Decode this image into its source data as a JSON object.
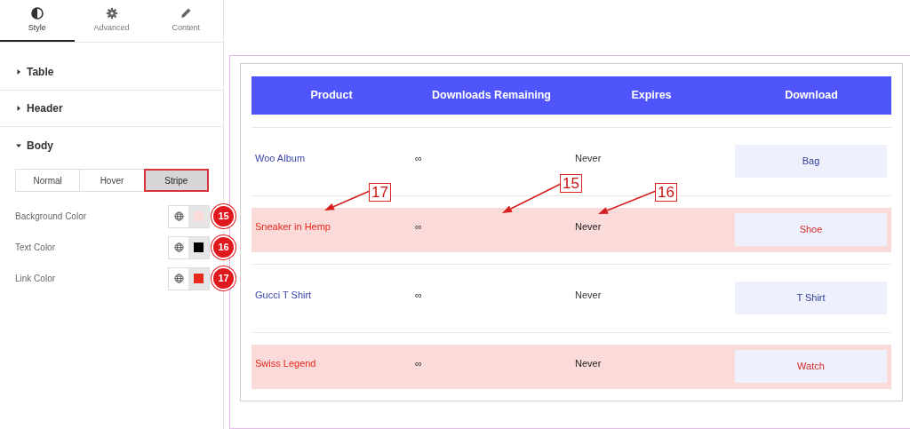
{
  "panel_tabs": [
    {
      "label": "Style",
      "selected": true
    },
    {
      "label": "Advanced",
      "selected": false
    },
    {
      "label": "Content",
      "selected": false
    }
  ],
  "sections": [
    {
      "label": "Table",
      "expanded": false
    },
    {
      "label": "Header",
      "expanded": false
    },
    {
      "label": "Body",
      "expanded": true
    }
  ],
  "state_tabs": [
    {
      "label": "Normal",
      "selected": false
    },
    {
      "label": "Hover",
      "selected": false
    },
    {
      "label": "Stripe",
      "selected": true
    }
  ],
  "color_controls": [
    {
      "label": "Background Color",
      "color": "#fbdada",
      "marker": "15"
    },
    {
      "label": "Text Color",
      "color": "#000000",
      "marker": "16"
    },
    {
      "label": "Link Color",
      "color": "#e8291c",
      "marker": "17"
    }
  ],
  "table": {
    "columns": [
      "Product",
      "Downloads Remaining",
      "Expires",
      "Download"
    ],
    "rows": [
      {
        "product": "Woo Album",
        "remaining": "∞",
        "expires": "Never",
        "download": "Bag",
        "striped": false
      },
      {
        "product": "Sneaker in Hemp",
        "remaining": "∞",
        "expires": "Never",
        "download": "Shoe",
        "striped": true
      },
      {
        "product": "Gucci T Shirt",
        "remaining": "∞",
        "expires": "Never",
        "download": "T Shirt",
        "striped": false
      },
      {
        "product": "Swiss Legend",
        "remaining": "∞",
        "expires": "Never",
        "download": "Watch",
        "striped": true
      }
    ]
  },
  "annotations": [
    {
      "label": "17"
    },
    {
      "label": "15"
    },
    {
      "label": "16"
    }
  ]
}
